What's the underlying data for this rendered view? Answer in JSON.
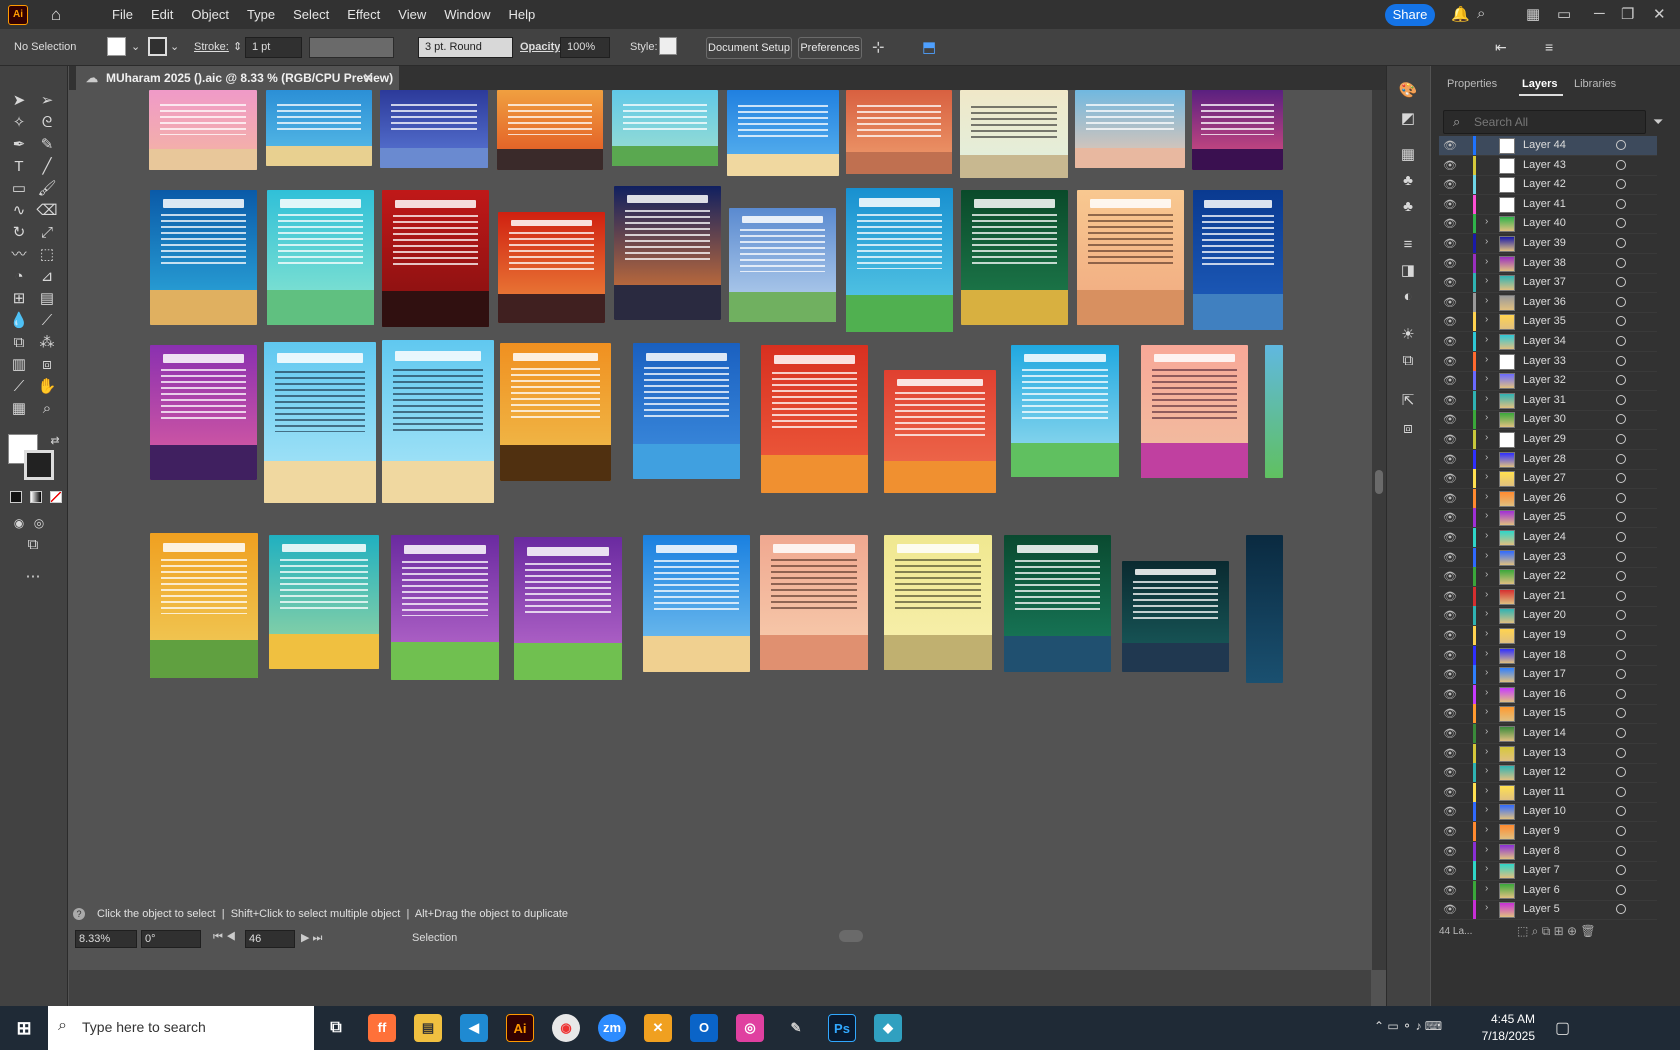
{
  "app": {
    "logo": "Ai",
    "menus": [
      "File",
      "Edit",
      "Object",
      "Type",
      "Select",
      "Effect",
      "View",
      "Window",
      "Help"
    ],
    "share_label": "Share"
  },
  "control": {
    "selection": "No Selection",
    "stroke_label": "Stroke:",
    "stroke_value": "1 pt",
    "brush": "3 pt. Round",
    "opacity_label": "Opacity:",
    "opacity_value": "100%",
    "style_label": "Style:",
    "doc_setup": "Document Setup",
    "preferences": "Preferences"
  },
  "document": {
    "tab_title": "MUharam 2025 ().aic @ 8.33 % (RGB/CPU Preview)"
  },
  "status": {
    "hint": "Click the object to select  |  Shift+Click to select multiple object  |  Alt+Drag the object to duplicate",
    "zoom": "8.33%",
    "rotate": "0°",
    "artboard": "46",
    "tool": "Selection"
  },
  "panel": {
    "tabs": [
      "Properties",
      "Layers",
      "Libraries"
    ],
    "search_placeholder": "Search All",
    "count": "44 La...",
    "layers": [
      "Layer 44",
      "Layer 43",
      "Layer 42",
      "Layer 41",
      "Layer 40",
      "Layer 39",
      "Layer 38",
      "Layer 37",
      "Layer 36",
      "Layer 35",
      "Layer 34",
      "Layer 33",
      "Layer 32",
      "Layer 31",
      "Layer 30",
      "Layer 29",
      "Layer 28",
      "Layer 27",
      "Layer 26",
      "Layer 25",
      "Layer 24",
      "Layer 23",
      "Layer 22",
      "Layer 21",
      "Layer 20",
      "Layer 19",
      "Layer 18",
      "Layer 17",
      "Layer 16",
      "Layer 15",
      "Layer 14",
      "Layer 13",
      "Layer 12",
      "Layer 11",
      "Layer 10",
      "Layer 9",
      "Layer 8",
      "Layer 7",
      "Layer 6",
      "Layer 5"
    ],
    "layer_colors": [
      "#1e73ff",
      "#d6c93a",
      "#6fd6e8",
      "#ff4fd6",
      "#2fb34a",
      "#1a1aa8",
      "#9a2fbf",
      "#2fb3b3",
      "#9a9a9a",
      "#ffd34f",
      "#2fc8d6",
      "#ff6a2f",
      "#6a6aff",
      "#2fb3b3",
      "#3aa83a",
      "#c8c83a",
      "#2f2fff",
      "#ffe04f",
      "#ff8a2f",
      "#a02fd6",
      "#2fd6c8",
      "#2f6aff",
      "#3aa83a",
      "#d62f2f",
      "#2fb3b3",
      "#ffd34f",
      "#2f2fff",
      "#2f7fff",
      "#c83aff",
      "#ff9a2f",
      "#3a8a3a",
      "#d6c83a",
      "#2fb3b3",
      "#ffe04f",
      "#2f6aff",
      "#ff8a2f",
      "#8a2fd6",
      "#2fd6c8",
      "#3aa83a",
      "#c82fd6"
    ]
  },
  "taskbar": {
    "search": "Type here to search",
    "time": "4:45 AM",
    "date": "7/18/2025"
  }
}
